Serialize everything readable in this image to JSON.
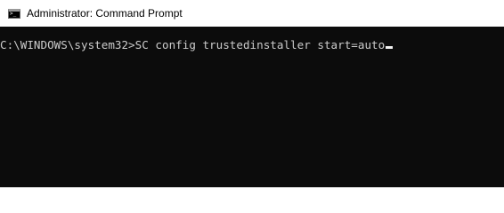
{
  "window": {
    "title": "Administrator: Command Prompt",
    "icon": "cmd-icon",
    "icon_glyph": ">_"
  },
  "console": {
    "prompt": "C:\\WINDOWS\\system32>",
    "command": "SC config trustedinstaller start=auto",
    "text_color": "#cccccc",
    "background_color": "#0c0c0c"
  }
}
